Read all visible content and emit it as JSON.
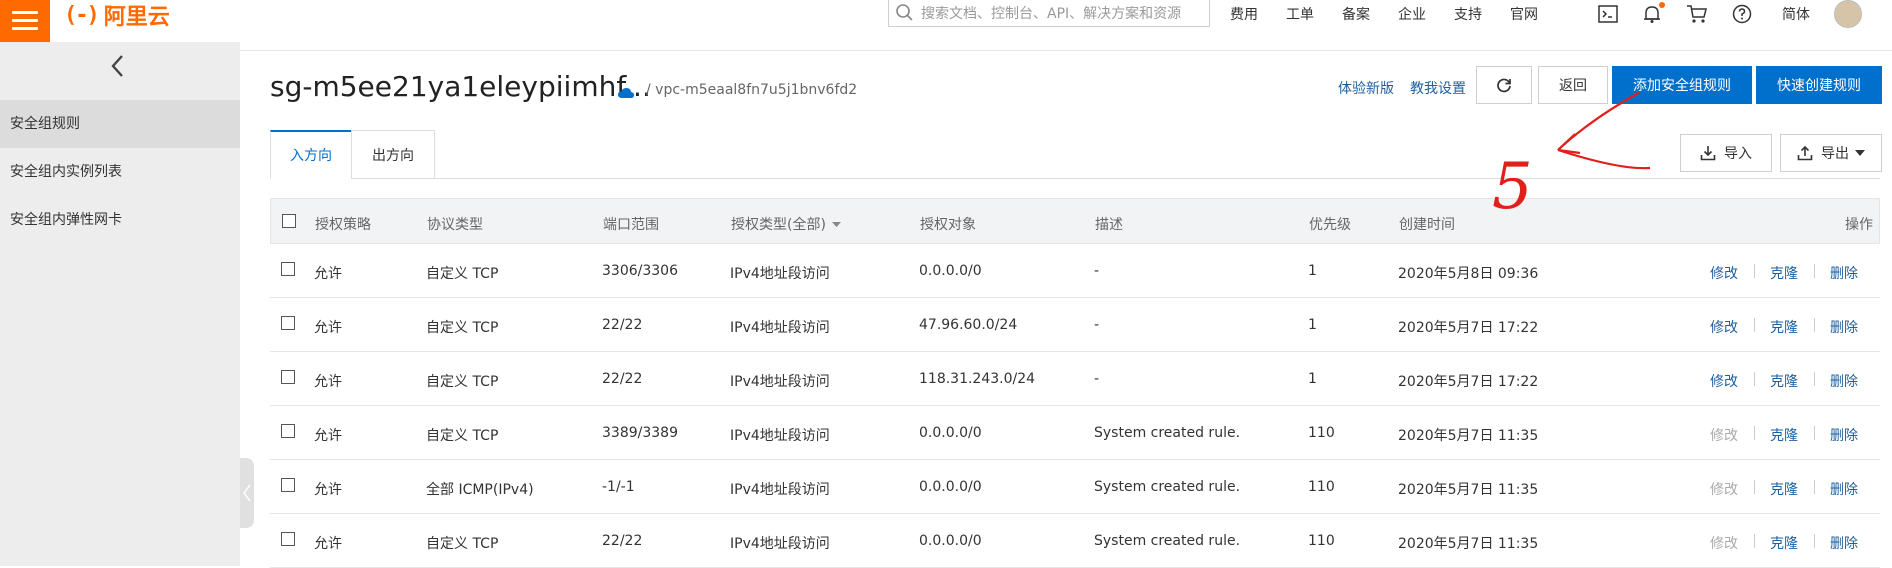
{
  "topbar": {
    "logo_mark": "(-)",
    "logo_text": "阿里云",
    "search_placeholder": "搜索文档、控制台、API、解决方案和资源",
    "nav": [
      "费用",
      "工单",
      "备案",
      "企业",
      "支持",
      "官网"
    ],
    "icons": [
      "terminal-icon",
      "bell-icon",
      "cart-icon",
      "help-icon"
    ],
    "lang": "简体"
  },
  "sidebar": {
    "items": [
      "安全组规则",
      "安全组内实例列表",
      "安全组内弹性网卡"
    ],
    "active_index": 0
  },
  "header": {
    "title": "sg-m5ee21ya1eleypiimhf...",
    "vpc": "/ vpc-m5eaal8fn7u5j1bnv6fd2",
    "link_new": "体验新版",
    "link_help": "教我设置",
    "back_button": "返回",
    "add_rule_button": "添加安全组规则",
    "quick_create_button": "快速创建规则",
    "import_button": "导入",
    "export_button": "导出"
  },
  "tabs": [
    "入方向",
    "出方向"
  ],
  "table": {
    "columns": [
      "授权策略",
      "协议类型",
      "端口范围",
      "授权类型(全部)",
      "授权对象",
      "描述",
      "优先级",
      "创建时间",
      "操作"
    ],
    "actions": [
      "修改",
      "克隆",
      "删除"
    ],
    "rows": [
      {
        "policy": "允许",
        "protocol": "自定义 TCP",
        "port": "3306/3306",
        "auth_type": "IPv4地址段访问",
        "object": "0.0.0.0/0",
        "desc": "-",
        "priority": "1",
        "created": "2020年5月8日 09:36",
        "edit_disabled": false
      },
      {
        "policy": "允许",
        "protocol": "自定义 TCP",
        "port": "22/22",
        "auth_type": "IPv4地址段访问",
        "object": "47.96.60.0/24",
        "desc": "-",
        "priority": "1",
        "created": "2020年5月7日 17:22",
        "edit_disabled": false
      },
      {
        "policy": "允许",
        "protocol": "自定义 TCP",
        "port": "22/22",
        "auth_type": "IPv4地址段访问",
        "object": "118.31.243.0/24",
        "desc": "-",
        "priority": "1",
        "created": "2020年5月7日 17:22",
        "edit_disabled": false
      },
      {
        "policy": "允许",
        "protocol": "自定义 TCP",
        "port": "3389/3389",
        "auth_type": "IPv4地址段访问",
        "object": "0.0.0.0/0",
        "desc": "System created rule.",
        "priority": "110",
        "created": "2020年5月7日 11:35",
        "edit_disabled": true
      },
      {
        "policy": "允许",
        "protocol": "全部 ICMP(IPv4)",
        "port": "-1/-1",
        "auth_type": "IPv4地址段访问",
        "object": "0.0.0.0/0",
        "desc": "System created rule.",
        "priority": "110",
        "created": "2020年5月7日 11:35",
        "edit_disabled": true
      },
      {
        "policy": "允许",
        "protocol": "自定义 TCP",
        "port": "22/22",
        "auth_type": "IPv4地址段访问",
        "object": "0.0.0.0/0",
        "desc": "System created rule.",
        "priority": "110",
        "created": "2020年5月7日 11:35",
        "edit_disabled": true
      }
    ]
  },
  "annotation": {
    "text": "5",
    "color": "#e0201a"
  },
  "colors": {
    "brand": "#ff6a00",
    "primary": "#0070cc",
    "link": "#1f5f9f"
  }
}
